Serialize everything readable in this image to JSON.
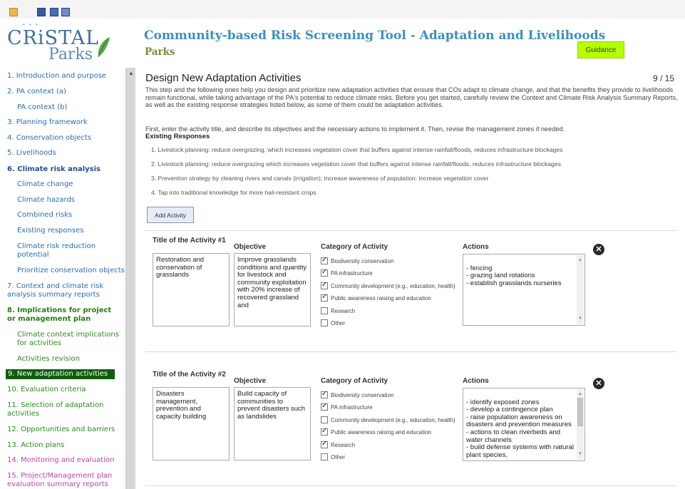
{
  "app": {
    "logo_top": "CRiSTAL",
    "logo_bottom": "Parks",
    "title": "Community-based Risk Screening Tool - Adaptation and Livelihoods",
    "subtitle": "Parks",
    "guidance_label": "Guidance"
  },
  "toolbar": {
    "icons": [
      "open-folder-icon",
      "save-icon",
      "save-as-icon",
      "export-icon"
    ]
  },
  "nav": [
    {
      "label": "1. Introduction and purpose"
    },
    {
      "label": "2. PA context (a)"
    },
    {
      "label": "PA context (b)"
    },
    {
      "label": "3. Planning framework"
    },
    {
      "label": "4. Conservation objects"
    },
    {
      "label": "5. Livelihoods"
    },
    {
      "label": "6. Climate risk analysis"
    },
    {
      "label": "Climate change"
    },
    {
      "label": "Climate hazards"
    },
    {
      "label": "Combined risks"
    },
    {
      "label": "Existing responses"
    },
    {
      "label": "Climate risk reduction"
    },
    {
      "label": "potential"
    },
    {
      "label": "Prioritize conservation objects"
    },
    {
      "label": "7. Context and climate risk"
    },
    {
      "label": "analysis summary reports"
    },
    {
      "label": "8. Implications for project"
    },
    {
      "label": "or management plan"
    },
    {
      "label": "Climate context implications"
    },
    {
      "label": "for activities"
    },
    {
      "label": "Activities revision"
    },
    {
      "label": "9. New adaptation activities"
    },
    {
      "label": "10. Evaluation criteria"
    },
    {
      "label": "11. Selection of adaptation"
    },
    {
      "label": "activities"
    },
    {
      "label": "12. Opportunities and barriers"
    },
    {
      "label": "13. Action plans"
    },
    {
      "label": "14. Monitoring and evaluation"
    },
    {
      "label": "15. Project/Management plan"
    },
    {
      "label": "evaluation summary reports"
    }
  ],
  "page": {
    "title": "Design New Adaptation Activities",
    "step": "9 / 15",
    "intro": "This step and the following ones help you design and prioritize new adaptation activities that ensure that COs adapt to climate change, and that the benefits they provide to livelihoods remain functional, while taking advantage of the PA's potential to reduce climate risks. Before you get started, carefully review the Context and Climate Risk Analysis Summary Reports, as well as the existing response strategies listed below, as some of them could be adaptation activities.",
    "intro2": "First, enter the activity title, and describe its objectives and the necessary actions to implement it. Then, revise the management zones if needed.",
    "existing_title": "Existing Responses",
    "existing": [
      "1. Livestock planning: reduce overgrazing, which increases vegetation cover that buffers against intense rainfall/floods, reduces infrastructure blockages",
      "2. Livestock planning: reduce overgrazing which increases vegetation cover that buffers against intense rainfall/floods, reduces infrastructure blockages",
      "3. Prevention strategy by cleaning rivers and canals (irrigation); increase awareness of population; increase vegetation cover",
      "4. Tap into traditional knowledge for more hail-resistant crops"
    ],
    "add_activity_label": "Add Activity"
  },
  "columns": {
    "objective": "Objective",
    "category": "Category of Activity",
    "actions": "Actions"
  },
  "activities": [
    {
      "title_label": "Title of the Activity #1",
      "title": "Restoration and conservation of grasslands",
      "objective": "Improve grasslands conditions and quantity for livestock and community exploitation with 20% increase of recovered grassland and",
      "categories": [
        {
          "label": "Biodiversity conservation",
          "checked": true
        },
        {
          "label": "PA infrastructure",
          "checked": true
        },
        {
          "label": "Community development (e.g., education, health)",
          "checked": true
        },
        {
          "label": "Public awareness raising and education",
          "checked": true
        },
        {
          "label": "Research",
          "checked": false
        },
        {
          "label": "Other",
          "checked": false
        }
      ],
      "actions": "- fencing\n- grazing land rotations\n- establish grasslands nurseries"
    },
    {
      "title_label": "Title of the Activity #2",
      "title": "Disasters management, prevention and capacity building",
      "objective": "Build capacity of communities to prevent disasters such as landslides",
      "categories": [
        {
          "label": "Biodiversity conservation",
          "checked": true
        },
        {
          "label": "PA infrastructure",
          "checked": true
        },
        {
          "label": "Community development (e.g., education, health)",
          "checked": false
        },
        {
          "label": "Public awareness raising and education",
          "checked": true
        },
        {
          "label": "Research",
          "checked": true
        },
        {
          "label": "Other",
          "checked": false
        }
      ],
      "actions": "- identify exposed zones\n- develop a contingence plan\n- raise population awareness on disasters and prevention measures\n- actions to clean riverbeds and water channels\n- build defense systems with natural plant species,"
    }
  ]
}
